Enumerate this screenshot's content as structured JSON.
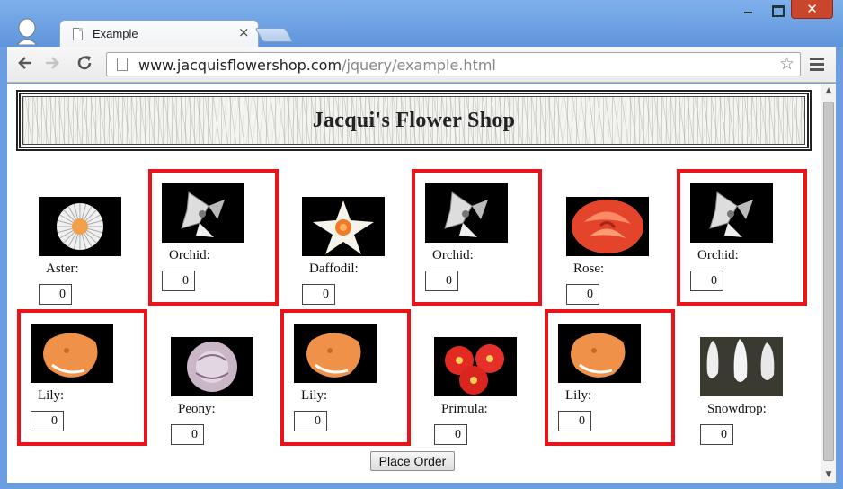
{
  "browser": {
    "tab_title": "Example",
    "tab_close": "×",
    "url_host": "www.jacquisflowershop.com",
    "url_path": "/jquery/example.html",
    "window_close": "✕"
  },
  "page": {
    "title": "Jacqui's Flower Shop",
    "order_button": "Place Order"
  },
  "flowers": [
    {
      "label": "Aster:",
      "qty": "0",
      "highlighted": false,
      "icon": "aster"
    },
    {
      "label": "Orchid:",
      "qty": "0",
      "highlighted": true,
      "icon": "orchid"
    },
    {
      "label": "Daffodil:",
      "qty": "0",
      "highlighted": false,
      "icon": "daffodil"
    },
    {
      "label": "Orchid:",
      "qty": "0",
      "highlighted": true,
      "icon": "orchid"
    },
    {
      "label": "Rose:",
      "qty": "0",
      "highlighted": false,
      "icon": "rose"
    },
    {
      "label": "Orchid:",
      "qty": "0",
      "highlighted": true,
      "icon": "orchid"
    },
    {
      "label": "Lily:",
      "qty": "0",
      "highlighted": true,
      "icon": "lily"
    },
    {
      "label": "Peony:",
      "qty": "0",
      "highlighted": false,
      "icon": "peony"
    },
    {
      "label": "Lily:",
      "qty": "0",
      "highlighted": true,
      "icon": "lily"
    },
    {
      "label": "Primula:",
      "qty": "0",
      "highlighted": false,
      "icon": "primula"
    },
    {
      "label": "Lily:",
      "qty": "0",
      "highlighted": true,
      "icon": "lily"
    },
    {
      "label": "Snowdrop:",
      "qty": "0",
      "highlighted": false,
      "icon": "snowdrop"
    }
  ],
  "colors": {
    "highlight_border": "#e8141a",
    "window_chrome": "#6b9ee0"
  }
}
